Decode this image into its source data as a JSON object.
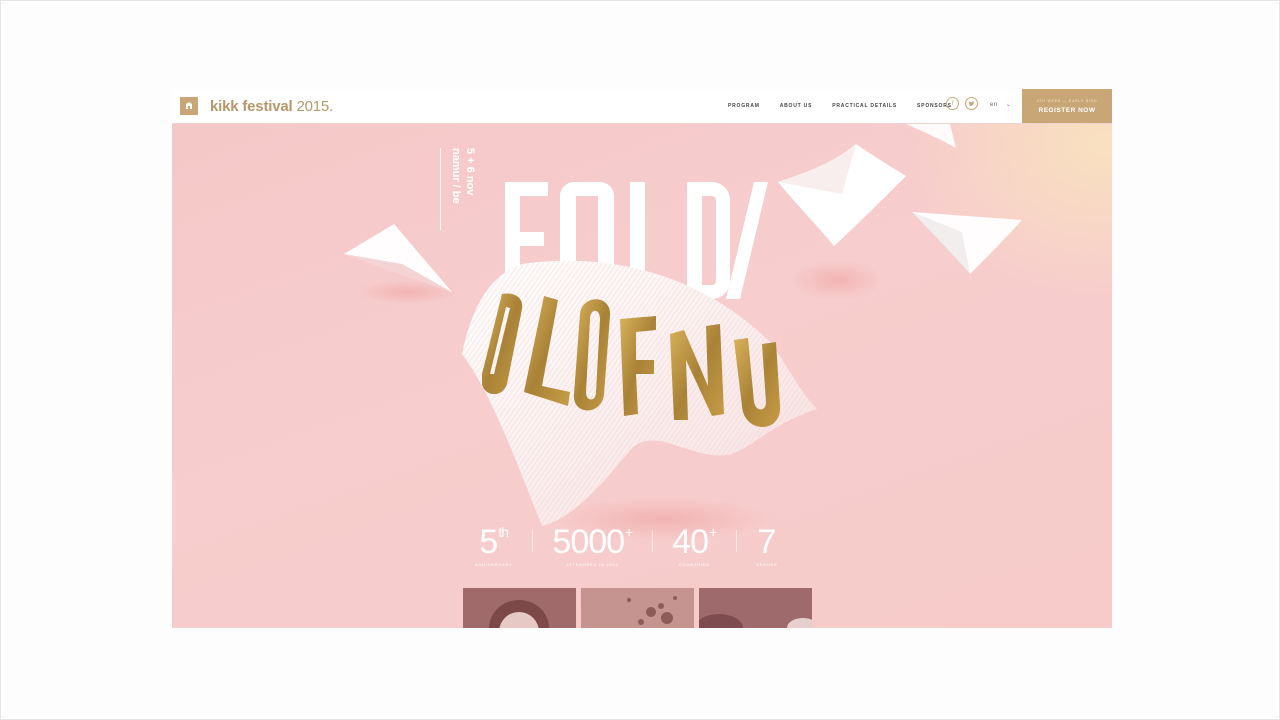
{
  "site": {
    "logo": {
      "name": "kikk festival",
      "year": "2015."
    },
    "nav": {
      "items": [
        "PROGRAM",
        "ABOUT US",
        "PRACTICAL DETAILS",
        "SPONSORS"
      ]
    },
    "social": [
      {
        "icon": "facebook-icon",
        "glyph": "f"
      },
      {
        "icon": "twitter-icon",
        "glyph": "t"
      }
    ],
    "language": {
      "selected": "en"
    },
    "register": {
      "sub": "4TH WEEK — EARLY BIRD",
      "label": "REGISTER NOW"
    }
  },
  "hero": {
    "date_line_1": "5 + 6 nov",
    "date_line_2": "namur / be",
    "headline_top": "FOLD /",
    "headline_bottom": "UNFOLD",
    "colors": {
      "background": "#f6cbca",
      "gold": "#c9a676",
      "gold_text": "#a98237"
    }
  },
  "stats": [
    {
      "number": "5",
      "sup": "th",
      "label": "ANNIVERSARY"
    },
    {
      "number": "5000",
      "sup": "+",
      "label": "ATTENDEES IN 2014"
    },
    {
      "number": "40",
      "sup": "+",
      "label": "COUNTRIES"
    },
    {
      "number": "7",
      "sup": "",
      "label": "VENUES"
    }
  ],
  "thumbnails": [
    {
      "icon": "portrait-thumbnail"
    },
    {
      "icon": "abstract-thumbnail"
    },
    {
      "icon": "portrait-thumbnail"
    }
  ]
}
